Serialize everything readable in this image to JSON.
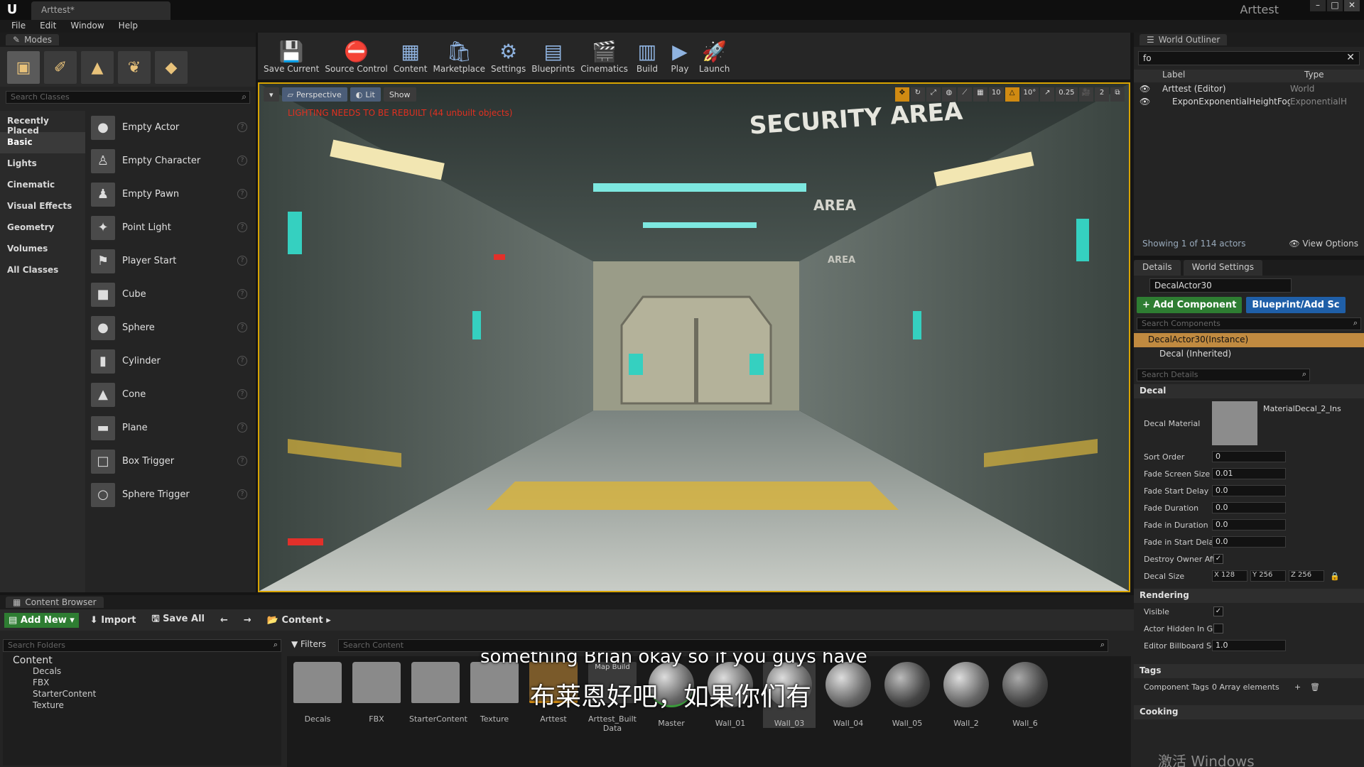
{
  "window": {
    "tab_title": "Arttest*",
    "project_name": "Arttest",
    "logo": "U"
  },
  "menu": [
    "File",
    "Edit",
    "Window",
    "Help"
  ],
  "modes": {
    "tab": "Modes",
    "search_placeholder": "Search Classes",
    "categories": [
      "Recently Placed",
      "Basic",
      "Lights",
      "Cinematic",
      "Visual Effects",
      "Geometry",
      "Volumes",
      "All Classes"
    ],
    "classes": [
      "Empty Actor",
      "Empty Character",
      "Empty Pawn",
      "Point Light",
      "Player Start",
      "Cube",
      "Sphere",
      "Cylinder",
      "Cone",
      "Plane",
      "Box Trigger",
      "Sphere Trigger"
    ]
  },
  "toolbar": {
    "buttons": [
      "Save Current",
      "Source Control",
      "Content",
      "Marketplace",
      "Settings",
      "Blueprints",
      "Cinematics",
      "Build",
      "Play",
      "Launch"
    ]
  },
  "viewport": {
    "perspective": "Perspective",
    "lit": "Lit",
    "show": "Show",
    "warning": "LIGHTING NEEDS TO BE REBUILT (44 unbuilt objects)",
    "snap_grid": "10",
    "snap_rot": "10°",
    "snap_scale": "0.25",
    "camera_speed": "2",
    "signs": [
      "SECURITY AREA",
      "AREA",
      "AREA"
    ]
  },
  "outliner": {
    "tab": "World Outliner",
    "search_value": "fo",
    "col_label": "Label",
    "col_type": "Type",
    "rows": [
      {
        "label": "Arttest (Editor)",
        "type": "World"
      },
      {
        "label": "ExponExponentialHeightFog",
        "type": "ExponentialHei"
      }
    ],
    "status": "Showing 1 of 114 actors",
    "view_options": "View Options"
  },
  "details": {
    "tab_details": "Details",
    "tab_world": "World Settings",
    "actor_name": "DecalActor30",
    "add_component": "+ Add Component",
    "blueprint": "Blueprint/Add Sc",
    "search_components": "Search Components",
    "components": [
      "DecalActor30(Instance)",
      "Decal (Inherited)"
    ],
    "search_details": "Search Details",
    "decal_section": "Decal",
    "decal_material_label": "Decal Material",
    "decal_material_value": "MaterialDecal_2_Ins",
    "props": [
      {
        "label": "Sort Order",
        "value": "0"
      },
      {
        "label": "Fade Screen Size",
        "value": "0.01"
      },
      {
        "label": "Fade Start Delay",
        "value": "0.0"
      },
      {
        "label": "Fade Duration",
        "value": "0.0"
      },
      {
        "label": "Fade in Duration",
        "value": "0.0"
      },
      {
        "label": "Fade in Start Delay",
        "value": "0.0"
      }
    ],
    "destroy_owner": "Destroy Owner Aft",
    "decal_size_label": "Decal Size",
    "decal_size": {
      "x": "X 128",
      "y": "Y 256",
      "z": "Z 256"
    },
    "rendering_section": "Rendering",
    "visible": "Visible",
    "actor_hidden": "Actor Hidden In Ga",
    "editor_billboard": "Editor Billboard Sc",
    "editor_billboard_value": "1.0",
    "tags_section": "Tags",
    "component_tags": "Component Tags",
    "component_tags_value": "0 Array elements",
    "cooking_section": "Cooking"
  },
  "content_browser": {
    "tab": "Content Browser",
    "add_new": "Add New",
    "import": "Import",
    "save_all": "Save All",
    "path": "Content",
    "search_folders": "Search Folders",
    "filters": "Filters",
    "search_content": "Search Content",
    "tree": [
      "Content",
      "Decals",
      "FBX",
      "StarterContent",
      "Texture"
    ],
    "assets": [
      {
        "label": "Decals",
        "kind": "folder"
      },
      {
        "label": "FBX",
        "kind": "folder"
      },
      {
        "label": "StarterContent",
        "kind": "folder"
      },
      {
        "label": "Texture",
        "kind": "folder"
      },
      {
        "label": "Arttest",
        "kind": "map"
      },
      {
        "label": "Arttest_Built Data",
        "kind": "map"
      },
      {
        "label": "Master",
        "kind": "material"
      },
      {
        "label": "Wall_01",
        "kind": "material"
      },
      {
        "label": "Wall_03",
        "kind": "material"
      },
      {
        "label": "Wall_04",
        "kind": "material"
      },
      {
        "label": "Wall_05",
        "kind": "sphere"
      },
      {
        "label": "Wall_2",
        "kind": "sphere"
      },
      {
        "label": "Wall_6",
        "kind": "sphere"
      }
    ],
    "map_build_label": "Map Build"
  },
  "subtitles": {
    "en": "something Brian okay so if you guys have",
    "zh": "布莱恩好吧，如果你们有"
  },
  "watermark": "激活 Windows"
}
